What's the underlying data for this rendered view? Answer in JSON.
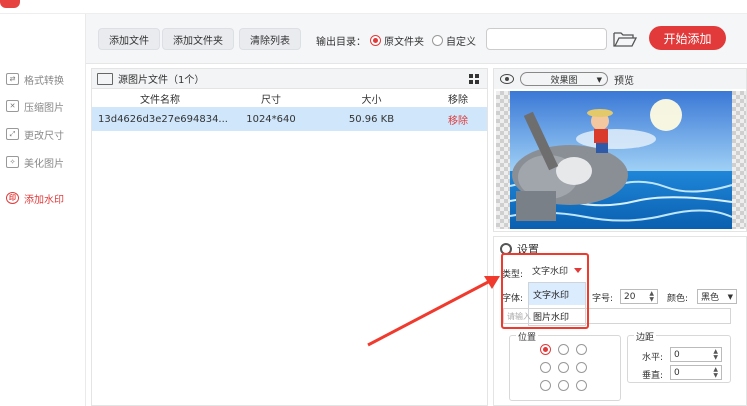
{
  "sidebar": {
    "items": [
      {
        "label": "格式转换",
        "icon": "convert-icon"
      },
      {
        "label": "压缩图片",
        "icon": "compress-icon"
      },
      {
        "label": "更改尺寸",
        "icon": "resize-icon"
      },
      {
        "label": "美化图片",
        "icon": "beautify-icon"
      },
      {
        "label": "添加水印",
        "icon": "watermark-icon",
        "active": true
      }
    ]
  },
  "toolbar": {
    "add_file": "添加文件",
    "add_folder": "添加文件夹",
    "clear_list": "清除列表",
    "output_label": "输出目录：",
    "radio_original": "原文件夹",
    "radio_custom": "自定义",
    "output_path": "",
    "start_label": "开始添加"
  },
  "filepanel": {
    "title": "源图片文件（1个）",
    "columns": {
      "name": "文件名称",
      "size": "尺寸",
      "filesize": "大小",
      "remove": "移除"
    },
    "rows": [
      {
        "name": "13d4626d3e27e694834...",
        "size": "1024*640",
        "filesize": "50.96 KB",
        "remove": "移除"
      }
    ]
  },
  "preview": {
    "mode": "效果图",
    "label": "预览"
  },
  "settings": {
    "title": "设置",
    "type_label": "类型:",
    "type_value": "文字水印",
    "font_label": "字体:",
    "dropdown_options": [
      "文字水印",
      "图片水印"
    ],
    "fontsize_label": "字号:",
    "fontsize_value": "20",
    "color_label": "颜色:",
    "color_value": "黑色",
    "text_placeholder": "请输入",
    "position_label": "位置",
    "margin_label": "边距",
    "horizontal_label": "水平:",
    "horizontal_value": "0",
    "vertical_label": "垂直:",
    "vertical_value": "0"
  },
  "colors": {
    "accent": "#e23a3a",
    "highlight_row": "#cfe6fb"
  }
}
